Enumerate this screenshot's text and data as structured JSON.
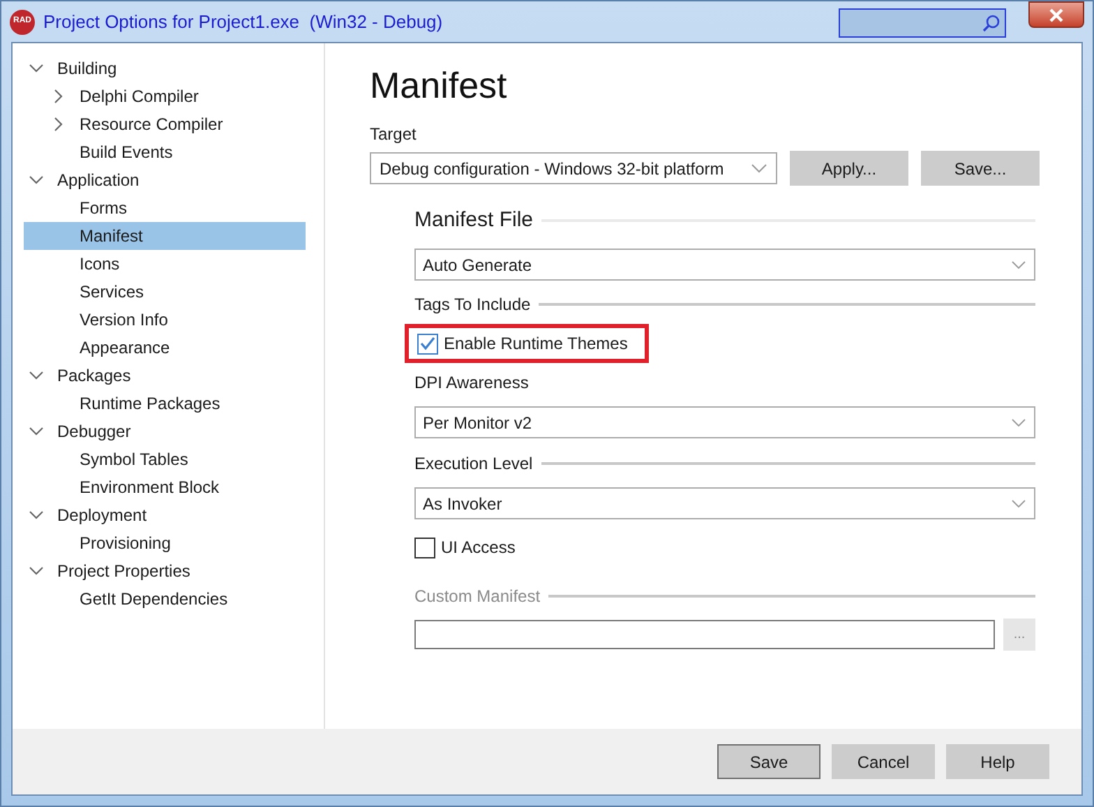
{
  "window": {
    "logo": "RAD",
    "title": "Project Options for Project1.exe  (Win32 - Debug)"
  },
  "tree": [
    {
      "label": "Building",
      "expanded": true,
      "selected": false,
      "children": [
        {
          "label": "Delphi Compiler",
          "expanded": false,
          "selected": false
        },
        {
          "label": "Resource Compiler",
          "expanded": false,
          "selected": false
        },
        {
          "label": "Build Events",
          "selected": false
        }
      ]
    },
    {
      "label": "Application",
      "expanded": true,
      "selected": false,
      "children": [
        {
          "label": "Forms",
          "selected": false
        },
        {
          "label": "Manifest",
          "selected": true
        },
        {
          "label": "Icons",
          "selected": false
        },
        {
          "label": "Services",
          "selected": false
        },
        {
          "label": "Version Info",
          "selected": false
        },
        {
          "label": "Appearance",
          "selected": false
        }
      ]
    },
    {
      "label": "Packages",
      "expanded": true,
      "selected": false,
      "children": [
        {
          "label": "Runtime Packages",
          "selected": false
        }
      ]
    },
    {
      "label": "Debugger",
      "expanded": true,
      "selected": false,
      "children": [
        {
          "label": "Symbol Tables",
          "selected": false
        },
        {
          "label": "Environment Block",
          "selected": false
        }
      ]
    },
    {
      "label": "Deployment",
      "expanded": true,
      "selected": false,
      "children": [
        {
          "label": "Provisioning",
          "selected": false
        }
      ]
    },
    {
      "label": "Project Properties",
      "expanded": true,
      "selected": false,
      "children": [
        {
          "label": "GetIt Dependencies",
          "selected": false
        }
      ]
    }
  ],
  "page": {
    "title": "Manifest",
    "target_label": "Target",
    "target_value": "Debug configuration - Windows 32-bit platform",
    "target_buttons": [
      "Apply...",
      "Save..."
    ],
    "group_title": "Manifest File",
    "rows": [
      {
        "kind": "combo",
        "value": "Auto Generate"
      },
      {
        "kind": "section",
        "label": "Tags To Include",
        "disabled": false
      },
      {
        "kind": "checkbox",
        "label": "Enable Runtime Themes",
        "checked": true,
        "highlighted": true
      },
      {
        "kind": "label",
        "label": "DPI Awareness"
      },
      {
        "kind": "combo",
        "value": "Per Monitor v2"
      },
      {
        "kind": "section",
        "label": "Execution Level",
        "disabled": false
      },
      {
        "kind": "combo",
        "value": "As Invoker"
      },
      {
        "kind": "checkbox",
        "label": "UI Access",
        "checked": false,
        "highlighted": false
      },
      {
        "kind": "section",
        "label": "Custom Manifest",
        "disabled": true
      },
      {
        "kind": "file",
        "button": "..."
      }
    ]
  },
  "footer_buttons": [
    {
      "label": "Save",
      "default": true
    },
    {
      "label": "Cancel",
      "default": false
    },
    {
      "label": "Help",
      "default": false
    }
  ]
}
